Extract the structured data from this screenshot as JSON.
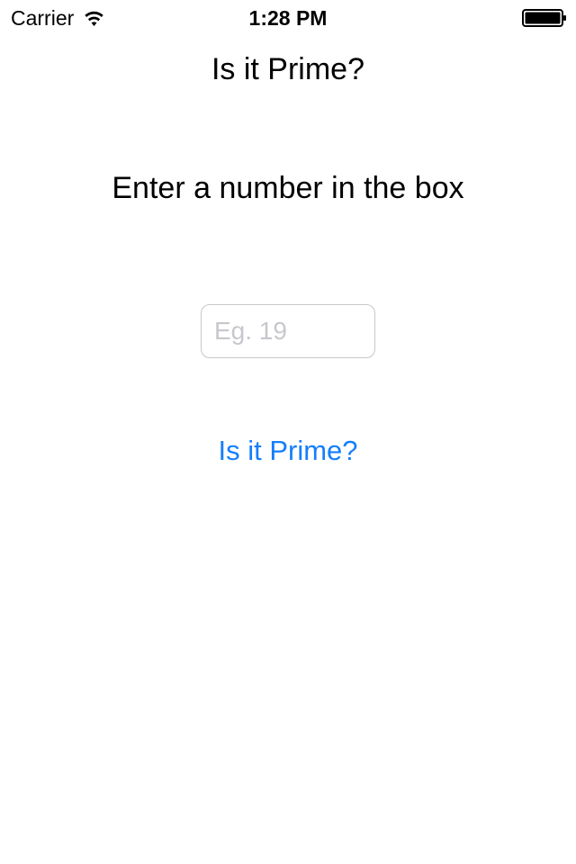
{
  "status_bar": {
    "carrier": "Carrier",
    "time": "1:28 PM",
    "wifi_icon": "wifi-icon",
    "battery_icon": "battery-full-icon"
  },
  "screen": {
    "title": "Is it Prime?",
    "instruction": "Enter a number in the box",
    "number_input": {
      "value": "",
      "placeholder": "Eg. 19"
    },
    "check_button_label": "Is it Prime?"
  },
  "colors": {
    "accent": "#157efb",
    "text": "#000000",
    "placeholder": "#c7c7cd",
    "field_border": "#c8c8c8",
    "background": "#ffffff"
  }
}
